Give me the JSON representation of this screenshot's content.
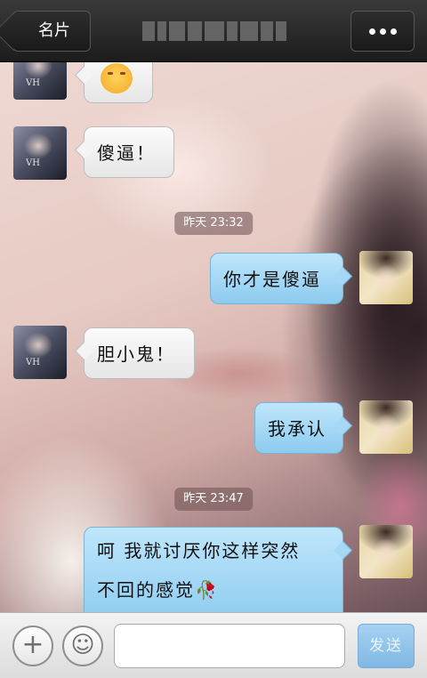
{
  "header": {
    "back_label": "名片",
    "title_obscured": "",
    "more_icon": "more-dots-icon"
  },
  "messages": [
    {
      "side": "left",
      "type": "emoji",
      "emoji_name": "hug-emoji"
    },
    {
      "side": "left",
      "text": "傻逼！"
    },
    {
      "type": "time",
      "text": "昨天 23:32"
    },
    {
      "side": "right",
      "text": "你才是傻逼"
    },
    {
      "side": "left",
      "text": "胆小鬼！"
    },
    {
      "side": "right",
      "text": "我承认"
    },
    {
      "type": "time",
      "text": "昨天 23:47"
    },
    {
      "side": "right",
      "text_line1": "呵  我就讨厌你这样突然",
      "text_line2": "不回的感觉",
      "emoji_name": "wilted-rose-icon"
    }
  ],
  "input_bar": {
    "plus_icon": "plus-icon",
    "emoji_icon": "smiley-icon",
    "input_value": "",
    "send_label": "发送"
  },
  "colors": {
    "topbar": "#1c1c1c",
    "bubble_left": "#f4f4f4",
    "bubble_right": "#a6d8f5",
    "send_button": "#80b8e4"
  }
}
